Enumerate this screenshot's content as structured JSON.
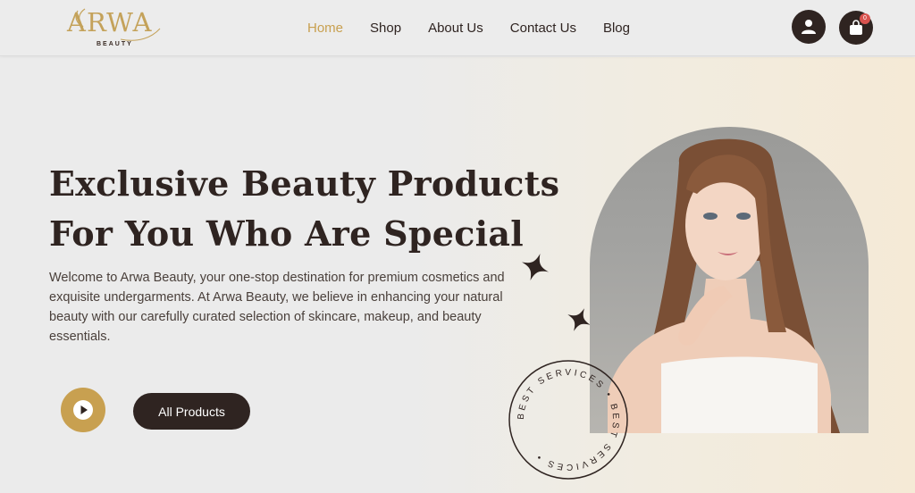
{
  "brand": {
    "name": "ARWA",
    "sub": "BEAUTY"
  },
  "nav": {
    "items": [
      {
        "label": "Home",
        "active": true
      },
      {
        "label": "Shop",
        "active": false
      },
      {
        "label": "About Us",
        "active": false
      },
      {
        "label": "Contact Us",
        "active": false
      },
      {
        "label": "Blog",
        "active": false
      }
    ]
  },
  "header": {
    "cart_count": "0",
    "user_icon": "user-icon",
    "cart_icon": "shopping-bag-icon"
  },
  "hero": {
    "title_line1": "Exclusive Beauty Products",
    "title_line2": "For You Who Are Special",
    "description": "Welcome to Arwa Beauty, your one-stop destination for premium cosmetics and exquisite undergarments. At Arwa Beauty, we believe in enhancing your natural beauty with our carefully curated selection of skincare, makeup, and beauty essentials.",
    "cta_label": "All Products",
    "play_icon": "play-icon",
    "badge_text": "BEST SERVICES • BEST SERVICES •"
  },
  "colors": {
    "accent": "#c8a050",
    "dark": "#2f2421",
    "background": "#ececec",
    "badge": "#d9534f"
  }
}
